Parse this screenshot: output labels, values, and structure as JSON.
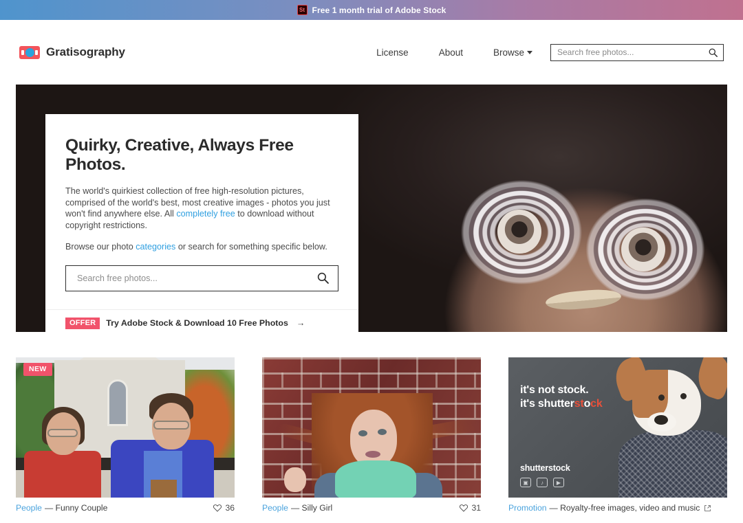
{
  "promo": {
    "icon": "adobe-stock-icon",
    "icon_label": "St",
    "text": "Free 1 month trial of Adobe Stock",
    "gradient_from": "#4f94cd",
    "gradient_to": "#c0718f"
  },
  "header": {
    "logo_text": "Gratisography",
    "logo_icon": "camera-logo-icon",
    "nav": [
      {
        "label": "License",
        "name": "nav-license"
      },
      {
        "label": "About",
        "name": "nav-about"
      },
      {
        "label": "Browse",
        "name": "nav-browse",
        "has_caret": true
      }
    ],
    "search": {
      "placeholder": "Search free photos...",
      "value": "",
      "icon": "search-icon"
    }
  },
  "hero": {
    "title": "Quirky, Creative, Always Free Photos.",
    "paragraph1_a": "The world's quirkiest collection of free high-resolution pictures, comprised of the world's best, most creative images - photos you just won't find anywhere else. All ",
    "paragraph1_link": "completely free",
    "paragraph1_b": " to download without copyright restrictions.",
    "paragraph2_a": "Browse our photo ",
    "paragraph2_link": "categories",
    "paragraph2_b": " or search for something specific below.",
    "search": {
      "placeholder": "Search free photos...",
      "value": "",
      "icon": "search-icon"
    },
    "offer": {
      "badge": "OFFER",
      "text": "Try Adobe Stock & Download 10 Free Photos",
      "arrow": "→",
      "badge_color": "#f1536b"
    },
    "image_alt": "man with tin can goggles"
  },
  "cards": [
    {
      "name": "card-funny-couple",
      "badge": "NEW",
      "category": "People",
      "separator": "—",
      "title": "Funny Couple",
      "likes": "36",
      "like_icon": "heart-icon",
      "external": false,
      "image_alt": "couple in hawaiian shirts in front of a house"
    },
    {
      "name": "card-silly-girl",
      "badge": "",
      "category": "People",
      "separator": "—",
      "title": "Silly Girl",
      "likes": "31",
      "like_icon": "heart-icon",
      "external": false,
      "image_alt": "red-haired girl pulling hair in front of brick wall"
    },
    {
      "name": "card-shutterstock-promo",
      "badge": "",
      "category": "Promotion",
      "separator": "—",
      "title": "Royalty-free images, video and music",
      "likes": "",
      "like_icon": "",
      "external": true,
      "external_icon": "external-link-icon",
      "image_alt": "shutterstock advertisement with dog in suit",
      "ad": {
        "headline_line1": "it's not stock.",
        "headline_line2_a": "it's shutter",
        "headline_line2_red": "st",
        "headline_line2_c": "o",
        "headline_line2_d": "ck",
        "brand": "shutterstock",
        "icons": [
          "camera-icon",
          "music-icon",
          "video-icon"
        ]
      }
    }
  ],
  "colors": {
    "accent_pink": "#f1536b",
    "link_blue": "#4aa3dd",
    "hero_link_blue": "#2f9fe0"
  }
}
